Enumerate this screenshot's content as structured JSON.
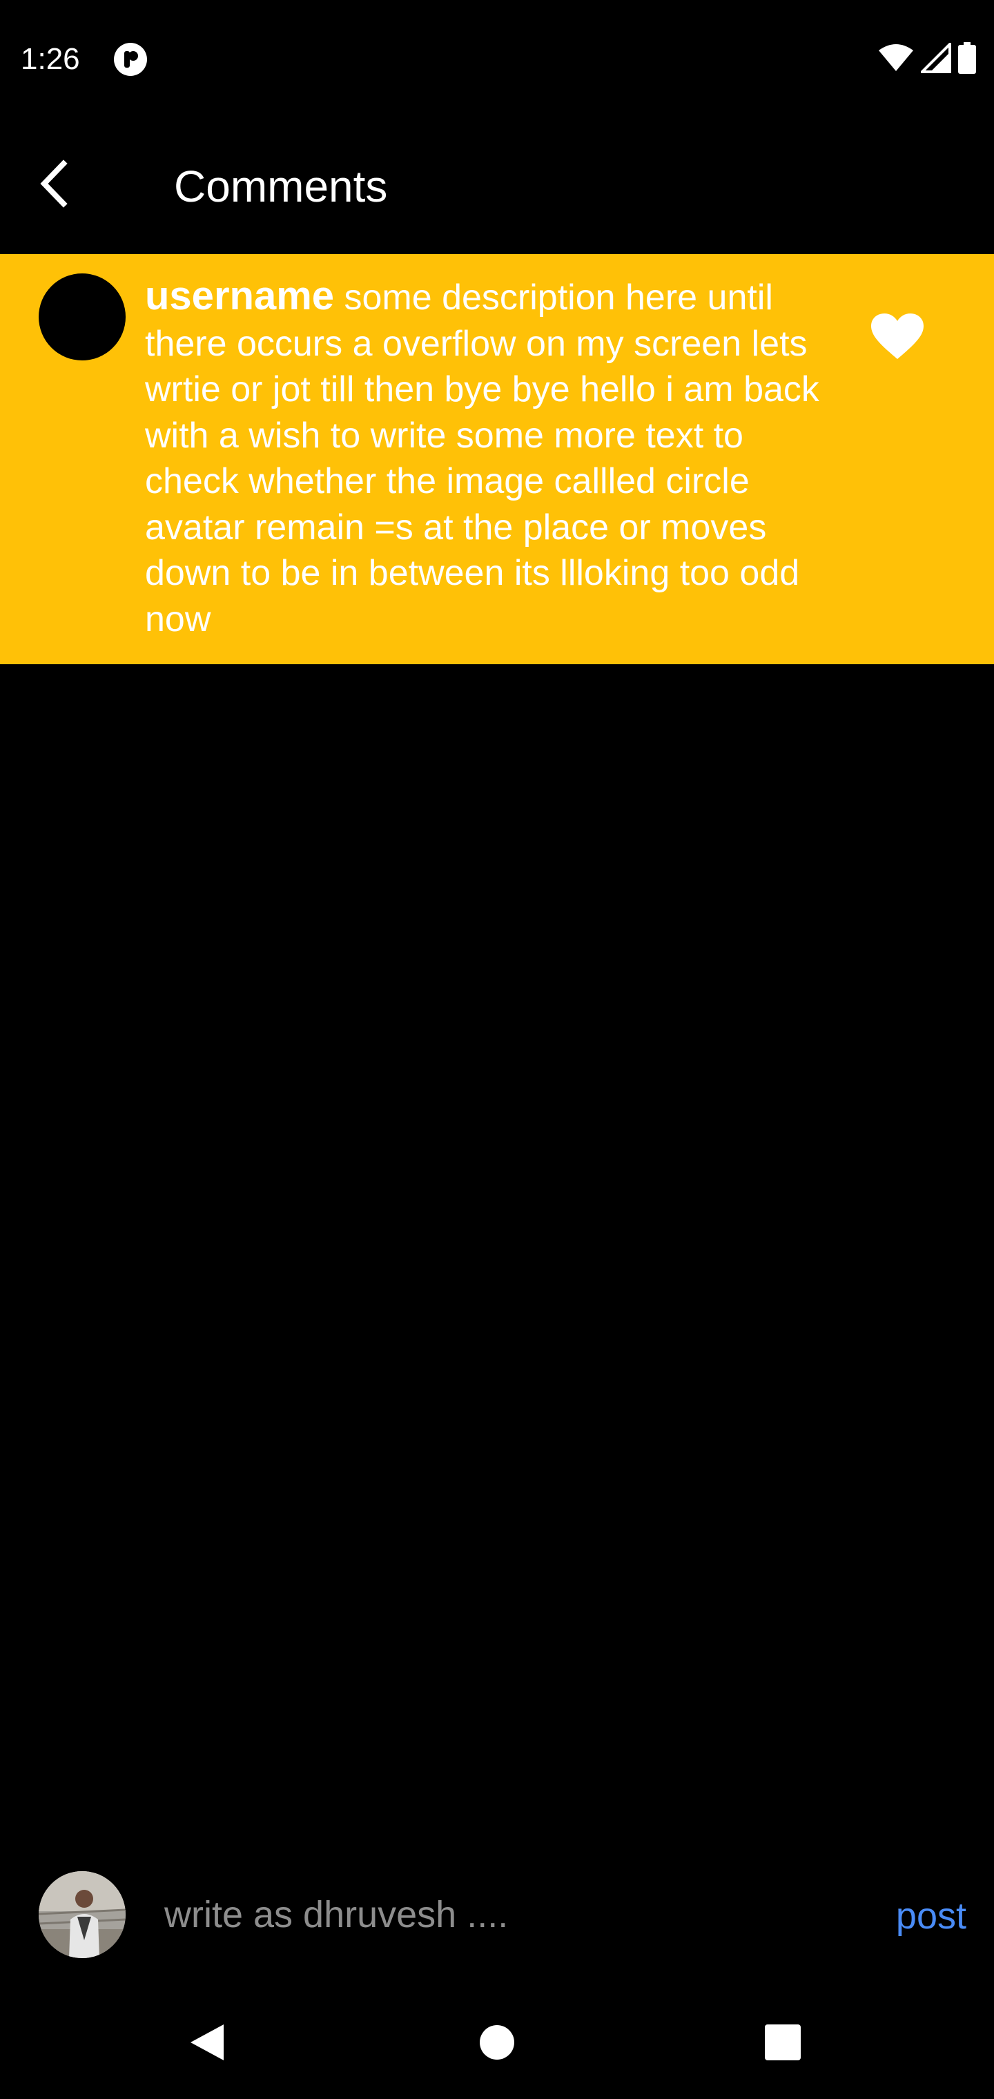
{
  "status_bar": {
    "time": "1:26",
    "icons": [
      "app-notification-icon",
      "wifi-icon",
      "cell-signal-icon",
      "battery-icon"
    ]
  },
  "app_bar": {
    "back_icon": "chevron-left-icon",
    "title": "Comments"
  },
  "comments": [
    {
      "username": "username",
      "text": "some description here until there occurs a overflow on my screen lets wrtie or jot till then bye bye  hello i am back with a wish to write some more text to check whether the image callled circle avatar remain =s at the place or moves down to be in between its llloking too odd now",
      "like_icon": "heart-icon"
    }
  ],
  "input_bar": {
    "placeholder": "write as dhruvesh ....",
    "post_label": "post"
  },
  "nav_bar": {
    "icons": [
      "nav-back-icon",
      "nav-home-icon",
      "nav-recents-icon"
    ]
  },
  "colors": {
    "background": "#000000",
    "card": "#FFC107",
    "text": "#FFFFFF",
    "placeholder": "#8D8D8D",
    "accent": "#4A8CF7"
  }
}
